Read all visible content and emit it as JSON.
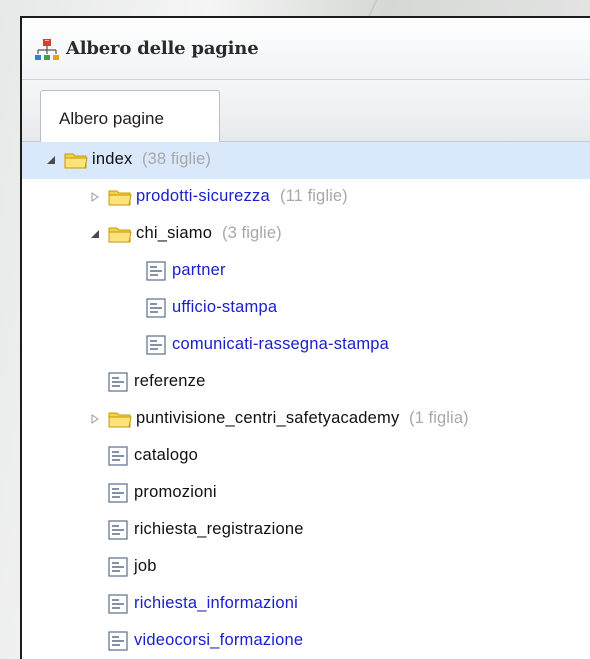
{
  "window": {
    "title": "Albero delle pagine"
  },
  "tabs": [
    {
      "label": "Albero pagine"
    }
  ],
  "tree": [
    {
      "label": "index",
      "count": "(38 figlie)",
      "type": "folder",
      "expander": "expanded",
      "link": false,
      "selected": true
    },
    {
      "label": "prodotti-sicurezza",
      "count": "(11 figlie)",
      "type": "folder",
      "expander": "collapsed",
      "link": true
    },
    {
      "label": "chi_siamo",
      "count": "(3 figlie)",
      "type": "folder",
      "expander": "expanded",
      "link": false
    },
    {
      "label": "partner",
      "count": "",
      "type": "page",
      "expander": "none",
      "link": true
    },
    {
      "label": "ufficio-stampa",
      "count": "",
      "type": "page",
      "expander": "none",
      "link": true
    },
    {
      "label": "comunicati-rassegna-stampa",
      "count": "",
      "type": "page",
      "expander": "none",
      "link": true
    },
    {
      "label": "referenze",
      "count": "",
      "type": "page",
      "expander": "none",
      "link": false
    },
    {
      "label": "puntivisione_centri_safetyacademy",
      "count": "(1 figlia)",
      "type": "folder",
      "expander": "collapsed",
      "link": false
    },
    {
      "label": "catalogo",
      "count": "",
      "type": "page",
      "expander": "none",
      "link": false
    },
    {
      "label": "promozioni",
      "count": "",
      "type": "page",
      "expander": "none",
      "link": false
    },
    {
      "label": "richiesta_registrazione",
      "count": "",
      "type": "page",
      "expander": "none",
      "link": false
    },
    {
      "label": "job",
      "count": "",
      "type": "page",
      "expander": "none",
      "link": false
    },
    {
      "label": "richiesta_informazioni",
      "count": "",
      "type": "page",
      "expander": "none",
      "link": true
    },
    {
      "label": "videocorsi_formazione",
      "count": "",
      "type": "page",
      "expander": "none",
      "link": true
    }
  ],
  "colors": {
    "link": "#1a21c9",
    "text": "#111111",
    "count": "#a8a8a8",
    "selection": "#d9e8fb",
    "folder": "#f1c400"
  }
}
